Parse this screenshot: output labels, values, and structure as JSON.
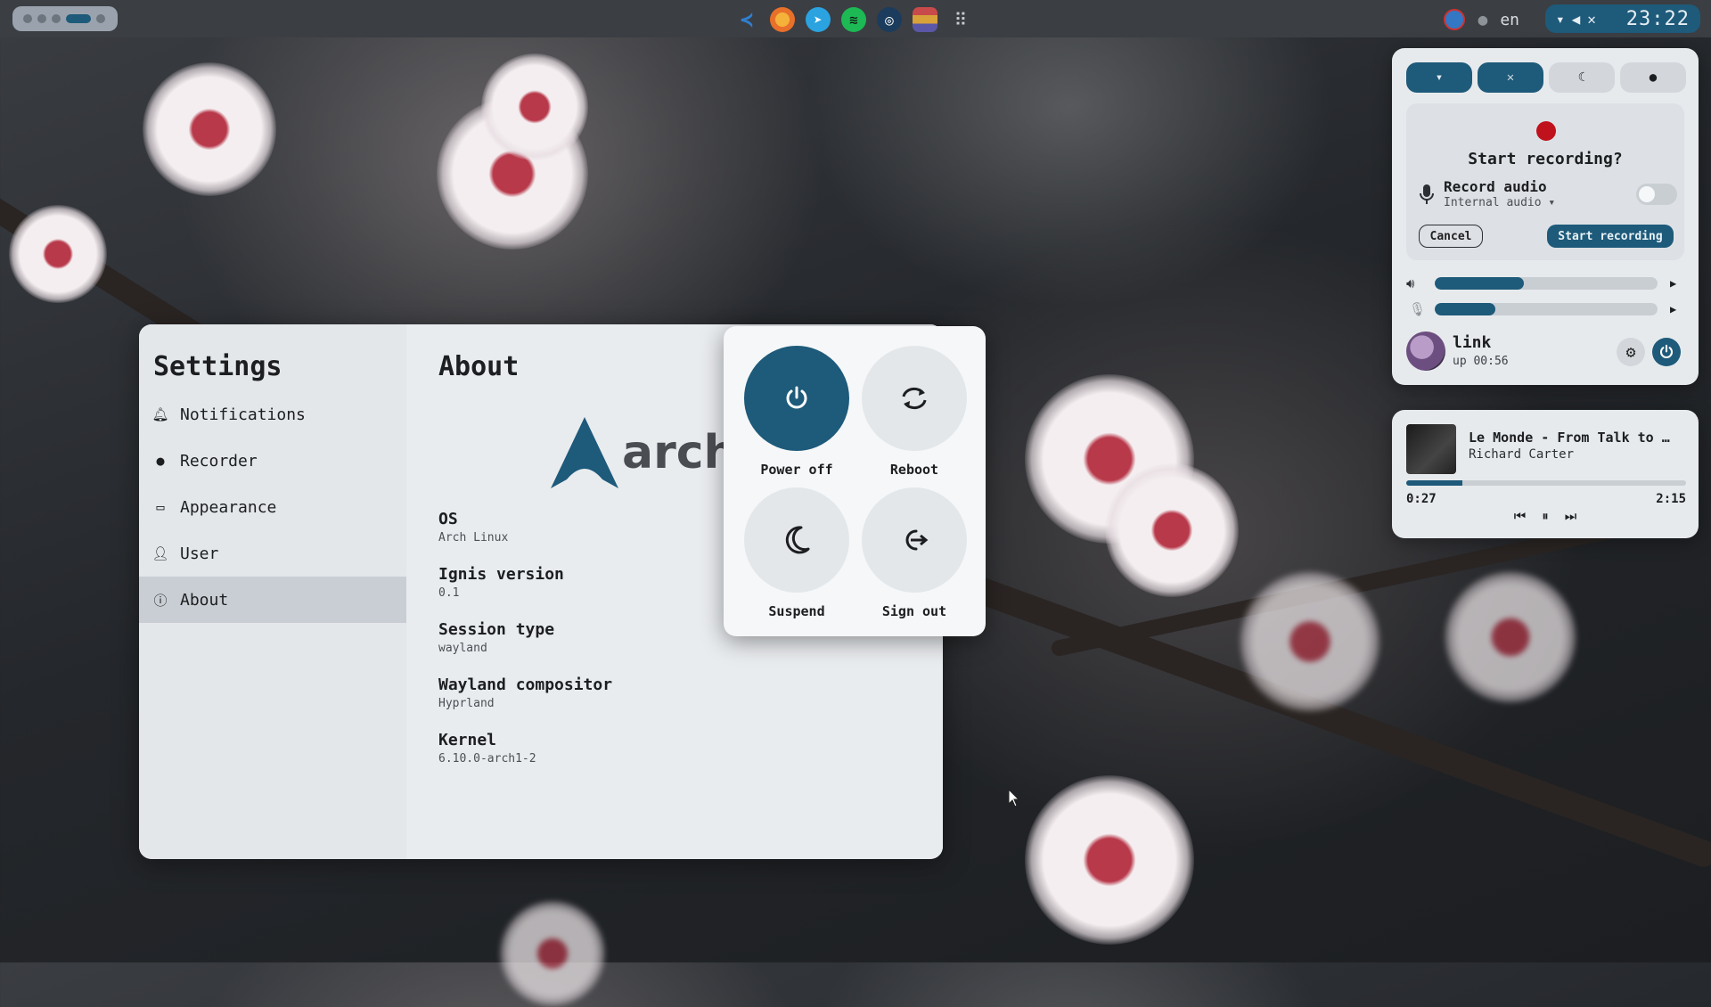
{
  "topbar": {
    "apps": [
      {
        "name": "vscode-icon",
        "color": "#2f7fd0"
      },
      {
        "name": "firefox-icon",
        "color": "#e8702a"
      },
      {
        "name": "telegram-icon",
        "color": "#2aa3e0"
      },
      {
        "name": "spotify-icon",
        "color": "#1db954"
      },
      {
        "name": "steam-icon",
        "color": "#1b3c5c"
      },
      {
        "name": "flag-icon",
        "color": "#c84a4a"
      },
      {
        "name": "app-grid-icon",
        "color": "#3b3e43"
      }
    ],
    "language": "en",
    "clock": "23:22"
  },
  "settings": {
    "title": "Settings",
    "nav": [
      {
        "label": "Notifications",
        "icon": "bell-icon"
      },
      {
        "label": "Recorder",
        "icon": "record-icon"
      },
      {
        "label": "Appearance",
        "icon": "monitor-icon"
      },
      {
        "label": "User",
        "icon": "user-icon"
      },
      {
        "label": "About",
        "icon": "info-icon"
      }
    ],
    "active": "About"
  },
  "about": {
    "title": "About",
    "logo_text": "archli",
    "rows": [
      {
        "label": "OS",
        "value": "Arch Linux"
      },
      {
        "label": "Ignis version",
        "value": "0.1"
      },
      {
        "label": "Session type",
        "value": "wayland"
      },
      {
        "label": "Wayland compositor",
        "value": "Hyprland"
      },
      {
        "label": "Kernel",
        "value": "6.10.0-arch1-2"
      }
    ]
  },
  "power_menu": {
    "power_off": "Power off",
    "reboot": "Reboot",
    "suspend": "Suspend",
    "sign_out": "Sign out"
  },
  "control_center": {
    "recorder": {
      "title": "Start recording?",
      "audio_label": "Record audio",
      "audio_source": "Internal audio",
      "audio_enabled": false,
      "cancel": "Cancel",
      "start": "Start recording"
    },
    "volume_level": 0.4,
    "mic_level": 0.27,
    "user": {
      "name": "link",
      "uptime": "up 00:56"
    }
  },
  "media": {
    "title": "Le Monde - From Talk to …",
    "artist": "Richard Carter",
    "current": "0:27",
    "total": "2:15",
    "progress": 0.2
  },
  "accent": "#1e5a7a"
}
